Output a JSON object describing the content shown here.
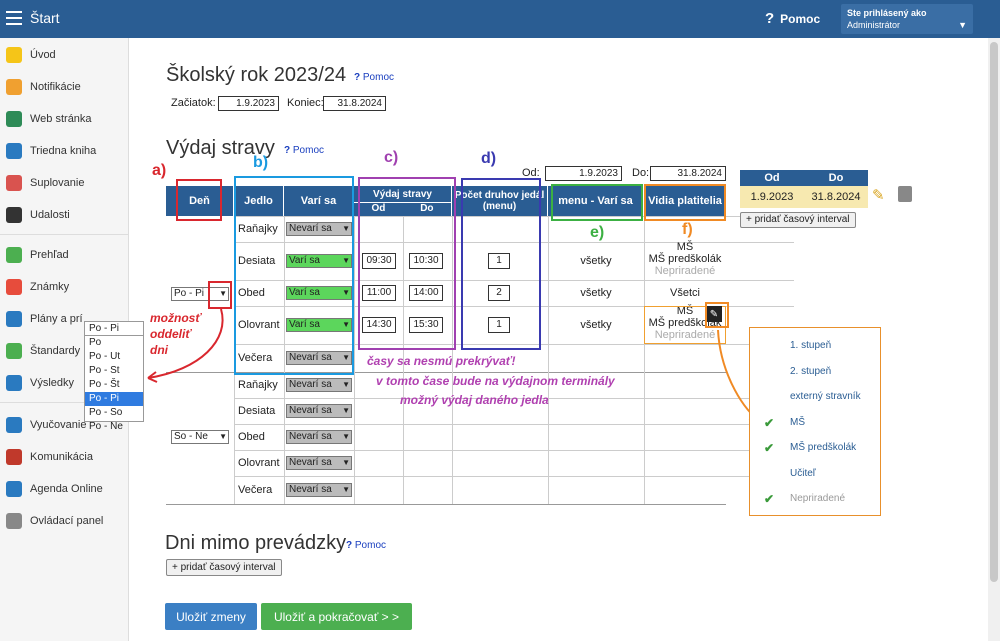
{
  "topbar": {
    "title": "Štart",
    "help": "Pomoc",
    "user_line1": "Ste prihlásený ako",
    "user_line2": "Administrátor"
  },
  "sidebar": {
    "items": [
      {
        "label": "Úvod",
        "color": "#f5c518"
      },
      {
        "label": "Notifikácie",
        "color": "#f0a030"
      },
      {
        "label": "Web stránka",
        "color": "#2e8b57"
      },
      {
        "label": "Triedna kniha",
        "color": "#2a7ac0"
      },
      {
        "label": "Suplovanie",
        "color": "#d9534f"
      },
      {
        "label": "Udalosti",
        "color": "#333333"
      },
      {
        "label": "Prehľad",
        "color": "#4caf50"
      },
      {
        "label": "Známky",
        "color": "#e74c3c"
      },
      {
        "label": "Plány a prí",
        "color": "#2a7ac0"
      },
      {
        "label": "Štandardy",
        "color": "#4caf50"
      },
      {
        "label": "Výsledky",
        "color": "#2a7ac0"
      },
      {
        "label": "Vyučovanie",
        "color": "#2a7ac0"
      },
      {
        "label": "Komunikácia",
        "color": "#c0392b"
      },
      {
        "label": "Agenda Online",
        "color": "#2a7ac0"
      },
      {
        "label": "Ovládací panel",
        "color": "#888888"
      }
    ]
  },
  "school_year": {
    "title": "Školský rok 2023/24",
    "help": "Pomoc",
    "start_label": "Začiatok:",
    "start_value": "1.9.2023",
    "end_label": "Koniec:",
    "end_value": "31.8.2024"
  },
  "meals": {
    "title": "Výdaj stravy",
    "help": "Pomoc",
    "od_label": "Od:",
    "od_value": "1.9.2023",
    "do_label": "Do:",
    "do_value": "31.8.2024"
  },
  "headers": {
    "den": "Deň",
    "jedlo": "Jedlo",
    "vari_sa": "Varí sa",
    "vydaj": "Výdaj stravy",
    "od": "Od",
    "do": "Do",
    "pocet": "Počet druhov jedál (menu)",
    "menu_vari": "menu - Varí sa",
    "vidia": "Vidia platitelia"
  },
  "group1": {
    "day": "Po - Pi",
    "rows": [
      {
        "jedlo": "Raňajky",
        "vari": "Nevarí sa",
        "state": "gray"
      },
      {
        "jedlo": "Desiata",
        "vari": "Varí sa",
        "state": "green",
        "od": "09:30",
        "do": "10:30",
        "count": "1",
        "menu": "všetky",
        "vidia1": "MŠ",
        "vidia2": "MŠ predškolák",
        "vidia3": "Nepriradené"
      },
      {
        "jedlo": "Obed",
        "vari": "Varí sa",
        "state": "green",
        "od": "11:00",
        "do": "14:00",
        "count": "2",
        "menu": "všetky",
        "vidia1": "Všetci"
      },
      {
        "jedlo": "Olovrant",
        "vari": "Varí sa",
        "state": "green",
        "od": "14:30",
        "do": "15:30",
        "count": "1",
        "menu": "všetky",
        "vidia1": "MŠ",
        "vidia2": "MŠ predškolák",
        "vidia3": "Nepriradené"
      },
      {
        "jedlo": "Večera",
        "vari": "Nevarí sa",
        "state": "gray"
      }
    ]
  },
  "group2": {
    "day": "So - Ne",
    "rows": [
      {
        "jedlo": "Raňajky",
        "vari": "Nevarí sa"
      },
      {
        "jedlo": "Desiata",
        "vari": "Nevarí sa"
      },
      {
        "jedlo": "Obed",
        "vari": "Nevarí sa"
      },
      {
        "jedlo": "Olovrant",
        "vari": "Nevarí sa"
      },
      {
        "jedlo": "Večera",
        "vari": "Nevarí sa"
      }
    ]
  },
  "dropdown": {
    "selected": "Po - Pi",
    "options": [
      "Po",
      "Po - Ut",
      "Po - St",
      "Po - Št",
      "Po - Pi",
      "Po - So",
      "Po - Ne"
    ]
  },
  "annotations": {
    "a": "a)",
    "b": "b)",
    "c": "c)",
    "d": "d)",
    "e": "e)",
    "f": "f)",
    "split1": "možnosť",
    "split2": "oddeliť",
    "split3": "dni",
    "note1": "časy sa nesmú prekrývať!",
    "note2": "v tomto čase bude na výdajnom terminály",
    "note3": "možný výdaj daného jedla"
  },
  "range": {
    "od_h": "Od",
    "do_h": "Do",
    "od": "1.9.2023",
    "do": "31.8.2024",
    "add": "+ pridať časový interval"
  },
  "popup": {
    "items": [
      {
        "label": "1. stupeň",
        "checked": false,
        "gray": false
      },
      {
        "label": "2. stupeň",
        "checked": false,
        "gray": false
      },
      {
        "label": "externý stravník",
        "checked": false,
        "gray": false
      },
      {
        "label": "MŠ",
        "checked": true,
        "gray": false
      },
      {
        "label": "MŠ predškolák",
        "checked": true,
        "gray": false
      },
      {
        "label": "Učiteľ",
        "checked": false,
        "gray": false
      },
      {
        "label": "Nepriradené",
        "checked": true,
        "gray": true
      }
    ]
  },
  "closed_days": {
    "title": "Dni mimo prevádzky",
    "help": "Pomoc",
    "add": "+ pridať časový interval"
  },
  "buttons": {
    "save": "Uložiť zmeny",
    "save_continue": "Uložiť a pokračovať > >"
  }
}
